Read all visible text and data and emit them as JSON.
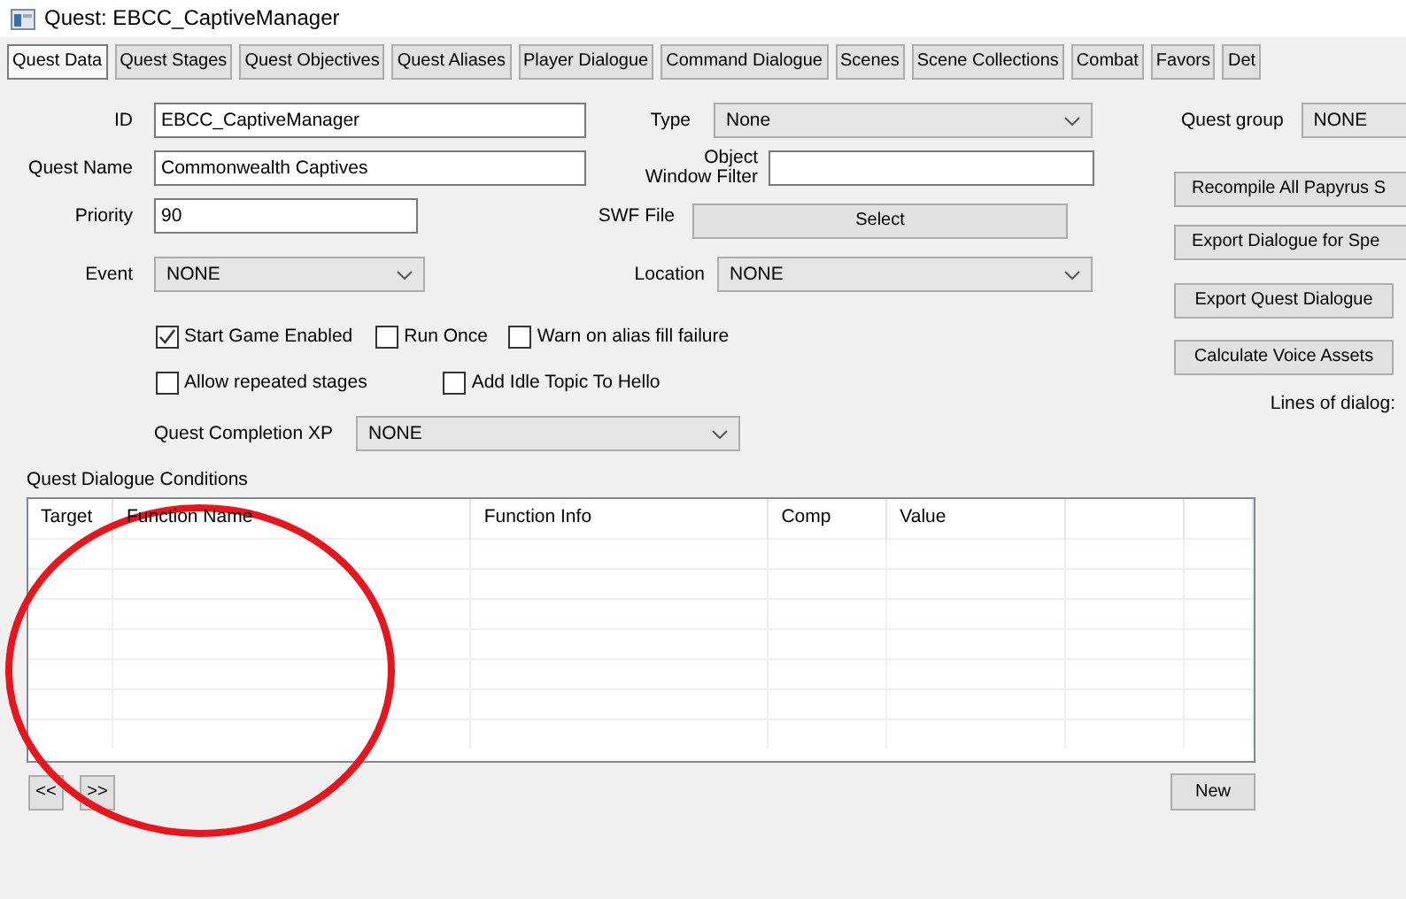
{
  "window": {
    "title": "Quest: EBCC_CaptiveManager"
  },
  "tabs": [
    {
      "label": "Quest Data",
      "selected": true
    },
    {
      "label": "Quest Stages",
      "selected": false
    },
    {
      "label": "Quest Objectives",
      "selected": false
    },
    {
      "label": "Quest Aliases",
      "selected": false
    },
    {
      "label": "Player Dialogue",
      "selected": false
    },
    {
      "label": "Command Dialogue",
      "selected": false
    },
    {
      "label": "Scenes",
      "selected": false
    },
    {
      "label": "Scene Collections",
      "selected": false
    },
    {
      "label": "Combat",
      "selected": false
    },
    {
      "label": "Favors",
      "selected": false
    },
    {
      "label": "Det",
      "selected": false
    }
  ],
  "quest_data": {
    "id": {
      "label": "ID",
      "value": "EBCC_CaptiveManager"
    },
    "quest_name": {
      "label": "Quest Name",
      "value": "Commonwealth Captives"
    },
    "priority": {
      "label": "Priority",
      "value": "90"
    },
    "event": {
      "label": "Event",
      "value": "NONE"
    },
    "type": {
      "label": "Type",
      "value": "None"
    },
    "object_window_filter": {
      "label": "Object Window Filter"
    },
    "swf_file": {
      "label": "SWF File",
      "button": "Select"
    },
    "location": {
      "label": "Location",
      "value": "NONE"
    },
    "quest_group": {
      "label": "Quest group",
      "value": "NONE"
    },
    "checkboxes": [
      {
        "label": "Start Game Enabled",
        "checked": true
      },
      {
        "label": "Run Once",
        "checked": false
      },
      {
        "label": "Warn on alias fill failure",
        "checked": false
      },
      {
        "label": "Allow repeated stages",
        "checked": false
      },
      {
        "label": "Add Idle Topic To Hello",
        "checked": false
      }
    ],
    "quest_completion_xp": {
      "label": "Quest Completion XP",
      "value": "NONE"
    },
    "buttons": [
      "Recompile All Papyrus S",
      "Export Dialogue for Spe",
      "Export Quest Dialogue",
      "Calculate Voice Assets"
    ],
    "lines_of_dialog": "Lines of dialog:"
  },
  "conditions": {
    "title": "Quest Dialogue Conditions",
    "columns": [
      "Target",
      "Function Name",
      "Function Info",
      "Comp",
      "Value"
    ],
    "nav_buttons": [
      "<<",
      ">>"
    ],
    "new_button": "New"
  }
}
